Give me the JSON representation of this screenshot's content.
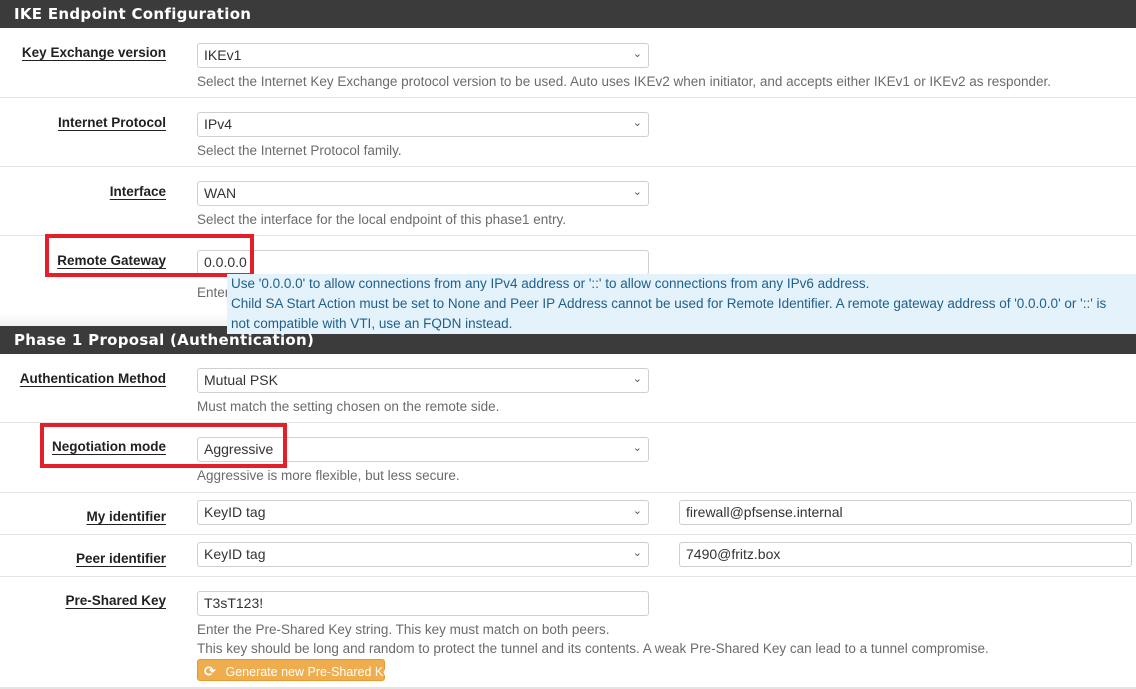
{
  "sections": {
    "ike": {
      "title": "IKE Endpoint Configuration"
    },
    "phase1": {
      "title": "Phase 1 Proposal (Authentication)"
    }
  },
  "fields": {
    "key_exchange": {
      "label": "Key Exchange version",
      "value": "IKEv1",
      "help": "Select the Internet Key Exchange protocol version to be used. Auto uses IKEv2 when initiator, and accepts either IKEv1 or IKEv2 as responder."
    },
    "internet_protocol": {
      "label": "Internet Protocol",
      "value": "IPv4",
      "help": "Select the Internet Protocol family."
    },
    "interface": {
      "label": "Interface",
      "value": "WAN",
      "help": "Select the interface for the local endpoint of this phase1 entry."
    },
    "remote_gateway": {
      "label": "Remote Gateway",
      "value": "0.0.0.0",
      "help_partial": "Enter",
      "tooltip": [
        "Use '0.0.0.0' to allow connections from any IPv4 address or '::' to allow connections from any IPv6 address.",
        "Child SA Start Action must be set to None and Peer IP Address cannot be used for Remote Identifier. A remote gateway address of '0.0.0.0' or '::' is",
        "not compatible with VTI, use an FQDN instead."
      ]
    },
    "auth_method": {
      "label": "Authentication Method",
      "value": "Mutual PSK",
      "help": "Must match the setting chosen on the remote side."
    },
    "negotiation_mode": {
      "label": "Negotiation mode",
      "value": "Aggressive",
      "help": "Aggressive is more flexible, but less secure."
    },
    "my_identifier": {
      "label": "My identifier",
      "type": "KeyID tag",
      "value": "firewall@pfsense.internal"
    },
    "peer_identifier": {
      "label": "Peer identifier",
      "type": "KeyID tag",
      "value": "7490@fritz.box"
    },
    "psk": {
      "label": "Pre-Shared Key",
      "value": "T3sT123!",
      "help1": "Enter the Pre-Shared Key string. This key must match on both peers.",
      "help2": "This key should be long and random to protect the tunnel and its contents. A weak Pre-Shared Key can lead to a tunnel compromise.",
      "generate_label": "Generate new Pre-Shared Key"
    }
  },
  "icons": {
    "chevron": "⌄",
    "refresh": "⟳"
  },
  "colors": {
    "header_bg": "#3b3b3b",
    "highlight": "#e3202a",
    "tooltip_bg": "#e3f2fb",
    "button": "#f0ad4e"
  }
}
